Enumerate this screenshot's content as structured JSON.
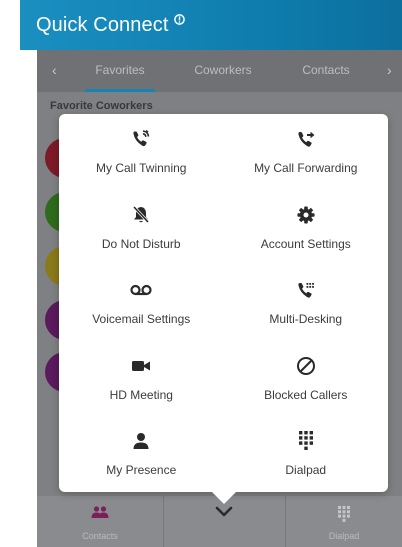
{
  "header": {
    "title": "Quick Connect",
    "info_icon": "info-circle-icon"
  },
  "tabs": {
    "items": [
      {
        "label": "Favorites",
        "active": true
      },
      {
        "label": "Coworkers",
        "active": false
      },
      {
        "label": "Contacts",
        "active": false
      }
    ],
    "left_arrow": "‹",
    "right_arrow": "›"
  },
  "list": {
    "section_label": "Favorite Coworkers",
    "avatar_colors": [
      "#7d1a27",
      "#2f6b1c",
      "#8a7a1a",
      "#5a1a5c",
      "#5a1a5c"
    ]
  },
  "menu": {
    "items": [
      {
        "label": "My Call Twinning",
        "icon": "call-twinning-icon"
      },
      {
        "label": "My Call Forwarding",
        "icon": "call-forwarding-icon"
      },
      {
        "label": "Do Not Disturb",
        "icon": "do-not-disturb-icon"
      },
      {
        "label": "Account Settings",
        "icon": "gear-icon"
      },
      {
        "label": "Voicemail Settings",
        "icon": "voicemail-icon"
      },
      {
        "label": "Multi-Desking",
        "icon": "multi-desking-icon"
      },
      {
        "label": "HD Meeting",
        "icon": "video-camera-icon"
      },
      {
        "label": "Blocked Callers",
        "icon": "blocked-icon"
      },
      {
        "label": "My Presence",
        "icon": "person-icon"
      },
      {
        "label": "Dialpad",
        "icon": "dialpad-icon"
      }
    ]
  },
  "bottom_nav": {
    "contacts_label": "Contacts",
    "dialpad_label": "Dialpad",
    "collapse_icon": "chevron-down-icon"
  },
  "colors": {
    "accent": "#1583b3",
    "header": "#1a8fc0",
    "icon": "#2a2a2d"
  }
}
